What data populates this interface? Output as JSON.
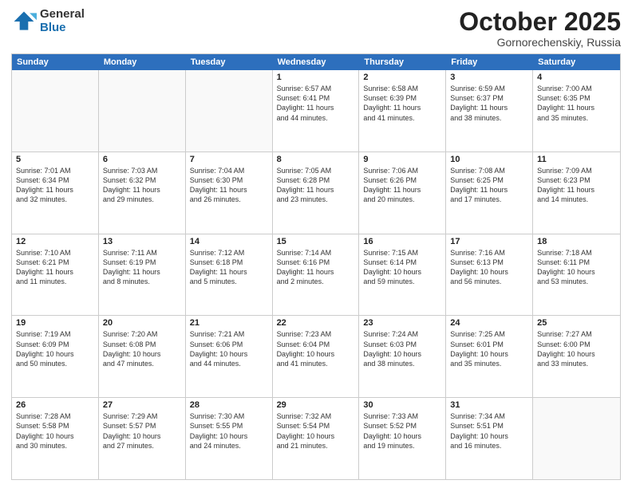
{
  "header": {
    "logo_general": "General",
    "logo_blue": "Blue",
    "month_title": "October 2025",
    "location": "Gornorechenskiy, Russia"
  },
  "weekdays": [
    "Sunday",
    "Monday",
    "Tuesday",
    "Wednesday",
    "Thursday",
    "Friday",
    "Saturday"
  ],
  "rows": [
    [
      {
        "day": "",
        "info": "",
        "empty": true
      },
      {
        "day": "",
        "info": "",
        "empty": true
      },
      {
        "day": "",
        "info": "",
        "empty": true
      },
      {
        "day": "1",
        "info": "Sunrise: 6:57 AM\nSunset: 6:41 PM\nDaylight: 11 hours\nand 44 minutes.",
        "empty": false
      },
      {
        "day": "2",
        "info": "Sunrise: 6:58 AM\nSunset: 6:39 PM\nDaylight: 11 hours\nand 41 minutes.",
        "empty": false
      },
      {
        "day": "3",
        "info": "Sunrise: 6:59 AM\nSunset: 6:37 PM\nDaylight: 11 hours\nand 38 minutes.",
        "empty": false
      },
      {
        "day": "4",
        "info": "Sunrise: 7:00 AM\nSunset: 6:35 PM\nDaylight: 11 hours\nand 35 minutes.",
        "empty": false
      }
    ],
    [
      {
        "day": "5",
        "info": "Sunrise: 7:01 AM\nSunset: 6:34 PM\nDaylight: 11 hours\nand 32 minutes.",
        "empty": false
      },
      {
        "day": "6",
        "info": "Sunrise: 7:03 AM\nSunset: 6:32 PM\nDaylight: 11 hours\nand 29 minutes.",
        "empty": false
      },
      {
        "day": "7",
        "info": "Sunrise: 7:04 AM\nSunset: 6:30 PM\nDaylight: 11 hours\nand 26 minutes.",
        "empty": false
      },
      {
        "day": "8",
        "info": "Sunrise: 7:05 AM\nSunset: 6:28 PM\nDaylight: 11 hours\nand 23 minutes.",
        "empty": false
      },
      {
        "day": "9",
        "info": "Sunrise: 7:06 AM\nSunset: 6:26 PM\nDaylight: 11 hours\nand 20 minutes.",
        "empty": false
      },
      {
        "day": "10",
        "info": "Sunrise: 7:08 AM\nSunset: 6:25 PM\nDaylight: 11 hours\nand 17 minutes.",
        "empty": false
      },
      {
        "day": "11",
        "info": "Sunrise: 7:09 AM\nSunset: 6:23 PM\nDaylight: 11 hours\nand 14 minutes.",
        "empty": false
      }
    ],
    [
      {
        "day": "12",
        "info": "Sunrise: 7:10 AM\nSunset: 6:21 PM\nDaylight: 11 hours\nand 11 minutes.",
        "empty": false
      },
      {
        "day": "13",
        "info": "Sunrise: 7:11 AM\nSunset: 6:19 PM\nDaylight: 11 hours\nand 8 minutes.",
        "empty": false
      },
      {
        "day": "14",
        "info": "Sunrise: 7:12 AM\nSunset: 6:18 PM\nDaylight: 11 hours\nand 5 minutes.",
        "empty": false
      },
      {
        "day": "15",
        "info": "Sunrise: 7:14 AM\nSunset: 6:16 PM\nDaylight: 11 hours\nand 2 minutes.",
        "empty": false
      },
      {
        "day": "16",
        "info": "Sunrise: 7:15 AM\nSunset: 6:14 PM\nDaylight: 10 hours\nand 59 minutes.",
        "empty": false
      },
      {
        "day": "17",
        "info": "Sunrise: 7:16 AM\nSunset: 6:13 PM\nDaylight: 10 hours\nand 56 minutes.",
        "empty": false
      },
      {
        "day": "18",
        "info": "Sunrise: 7:18 AM\nSunset: 6:11 PM\nDaylight: 10 hours\nand 53 minutes.",
        "empty": false
      }
    ],
    [
      {
        "day": "19",
        "info": "Sunrise: 7:19 AM\nSunset: 6:09 PM\nDaylight: 10 hours\nand 50 minutes.",
        "empty": false
      },
      {
        "day": "20",
        "info": "Sunrise: 7:20 AM\nSunset: 6:08 PM\nDaylight: 10 hours\nand 47 minutes.",
        "empty": false
      },
      {
        "day": "21",
        "info": "Sunrise: 7:21 AM\nSunset: 6:06 PM\nDaylight: 10 hours\nand 44 minutes.",
        "empty": false
      },
      {
        "day": "22",
        "info": "Sunrise: 7:23 AM\nSunset: 6:04 PM\nDaylight: 10 hours\nand 41 minutes.",
        "empty": false
      },
      {
        "day": "23",
        "info": "Sunrise: 7:24 AM\nSunset: 6:03 PM\nDaylight: 10 hours\nand 38 minutes.",
        "empty": false
      },
      {
        "day": "24",
        "info": "Sunrise: 7:25 AM\nSunset: 6:01 PM\nDaylight: 10 hours\nand 35 minutes.",
        "empty": false
      },
      {
        "day": "25",
        "info": "Sunrise: 7:27 AM\nSunset: 6:00 PM\nDaylight: 10 hours\nand 33 minutes.",
        "empty": false
      }
    ],
    [
      {
        "day": "26",
        "info": "Sunrise: 7:28 AM\nSunset: 5:58 PM\nDaylight: 10 hours\nand 30 minutes.",
        "empty": false
      },
      {
        "day": "27",
        "info": "Sunrise: 7:29 AM\nSunset: 5:57 PM\nDaylight: 10 hours\nand 27 minutes.",
        "empty": false
      },
      {
        "day": "28",
        "info": "Sunrise: 7:30 AM\nSunset: 5:55 PM\nDaylight: 10 hours\nand 24 minutes.",
        "empty": false
      },
      {
        "day": "29",
        "info": "Sunrise: 7:32 AM\nSunset: 5:54 PM\nDaylight: 10 hours\nand 21 minutes.",
        "empty": false
      },
      {
        "day": "30",
        "info": "Sunrise: 7:33 AM\nSunset: 5:52 PM\nDaylight: 10 hours\nand 19 minutes.",
        "empty": false
      },
      {
        "day": "31",
        "info": "Sunrise: 7:34 AM\nSunset: 5:51 PM\nDaylight: 10 hours\nand 16 minutes.",
        "empty": false
      },
      {
        "day": "",
        "info": "",
        "empty": true
      }
    ]
  ]
}
